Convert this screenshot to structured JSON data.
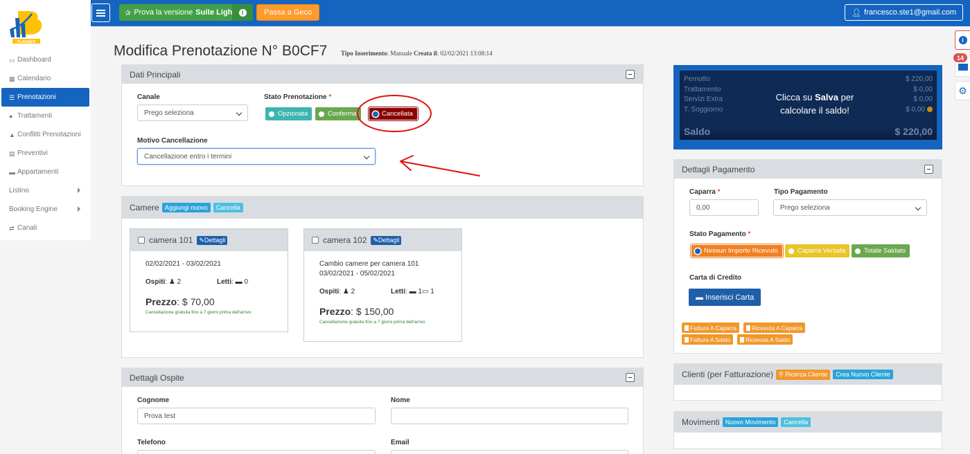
{
  "topbar": {
    "suite_label_prefix": "Prova la versione",
    "suite_label_bold": "Suite Light",
    "geco_label": "Passa a Geco",
    "user_email": "francesco.ste1@gmail.com"
  },
  "logo": {
    "text": "PLANNER"
  },
  "sidebar": {
    "items": [
      {
        "label": "Dashboard"
      },
      {
        "label": "Calendario"
      },
      {
        "label": "Prenotazioni"
      },
      {
        "label": "Trattamenti"
      },
      {
        "label": "Conflitti Prenotazioni"
      },
      {
        "label": "Preventivi"
      },
      {
        "label": "Appartamenti"
      },
      {
        "label": "Listino"
      },
      {
        "label": "Booking Engine"
      },
      {
        "label": "Canali"
      }
    ]
  },
  "notifications": {
    "mail_count": "14"
  },
  "page": {
    "title": "Modifica Prenotazione N° B0CF7",
    "meta_tipo_label": "Tipo Inserimento",
    "meta_tipo_value": ": Manuale",
    "meta_creata_label": "Creata il",
    "meta_creata_value": ": 02/02/2021 13:08:14"
  },
  "dati_principali": {
    "title": "Dati Principali",
    "canale_label": "Canale",
    "canale_value": "Prego seleziona",
    "stato_label": "Stato Prenotazione",
    "req": "*",
    "stati": [
      "Opzionata",
      "Conferma",
      "Cancellata"
    ],
    "motivo_label": "Motivo Cancellazione",
    "motivo_value": "Cancellazione entro i termini"
  },
  "camere": {
    "title": "Camere",
    "add_label": "Aggiungi nuovo",
    "cancel_label": "Cancella",
    "details_label": "Dettagli",
    "rooms": [
      {
        "name": "camera 101",
        "note": "",
        "dates": "02/02/2021 - 03/02/2021",
        "ospiti_label": "Ospiti",
        "ospiti": "2",
        "letti_label": "Letti",
        "letti": "0",
        "letti2": "",
        "prezzo_label": "Prezzo",
        "prezzo": ": $ 70,00",
        "cancel_note": "Cancellazione gratuita fino a 7 giorni prima dell'arrivo"
      },
      {
        "name": "camera 102",
        "note": "Cambio camere per camera 101",
        "dates": "03/02/2021 - 05/02/2021",
        "ospiti_label": "Ospiti",
        "ospiti": "2",
        "letti_label": "Letti",
        "letti": "1",
        "letti2": "1",
        "prezzo_label": "Prezzo",
        "prezzo": ": $ 150,00",
        "cancel_note": "Cancellazione gratuita fino a 7 giorni prima dell'arrivo"
      }
    ]
  },
  "ospite": {
    "title": "Dettagli Ospite",
    "cognome_label": "Cognome",
    "cognome_value": "Prova test",
    "nome_label": "Nome",
    "nome_value": "",
    "telefono_label": "Telefono",
    "email_label": "Email"
  },
  "summary": {
    "rows": [
      {
        "label": "Pernotto",
        "value": "$ 220,00"
      },
      {
        "label": "Trattamento",
        "value": "$ 0,00"
      },
      {
        "label": "Servizi Extra",
        "value": "$ 0,00"
      },
      {
        "label": "T. Soggiorno",
        "value": "$ 0,00"
      }
    ],
    "msg_1": "Clicca su",
    "msg_bold": "Salva",
    "msg_2": "per",
    "msg_3": "calcolare il saldo!",
    "saldo_label": "Saldo",
    "saldo_value": "$ 220,00"
  },
  "pagamento": {
    "title": "Dettagli Pagamento",
    "caparra_label": "Caparra",
    "caparra_value": "0,00",
    "tipo_label": "Tipo Pagamento",
    "tipo_value": "Prego seleziona",
    "stato_label": "Stato Pagamento",
    "stati": [
      "Nessun Importo Ricevuto",
      "Caparra Versata",
      "Totale Saldato"
    ],
    "carta_label": "Carta di Credito",
    "carta_btn": "Inserisci Carta",
    "docs": [
      "Fattura A Caparra",
      "Ricevuta A Caparra",
      "Fattura A Saldo",
      "Ricevuta A Saldo"
    ]
  },
  "clienti": {
    "title": "Clienti (per Fatturazione)",
    "search_label": "Ricerca Cliente",
    "new_label": "Crea Nuovo Cliente"
  },
  "movimenti": {
    "title": "Movimenti",
    "new_label": "Nuovo Movimento",
    "cancel_label": "Cancella"
  },
  "colors": {
    "primary": "#1565c0",
    "opzionata": "#3db5b0",
    "conferma": "#6aa84f",
    "cancellata": "#8b0000",
    "nessun_importo": "#f07f22",
    "caparra_versata": "#e8c52a",
    "totale_saldato": "#6aa84f",
    "annotation": "#e01010"
  }
}
